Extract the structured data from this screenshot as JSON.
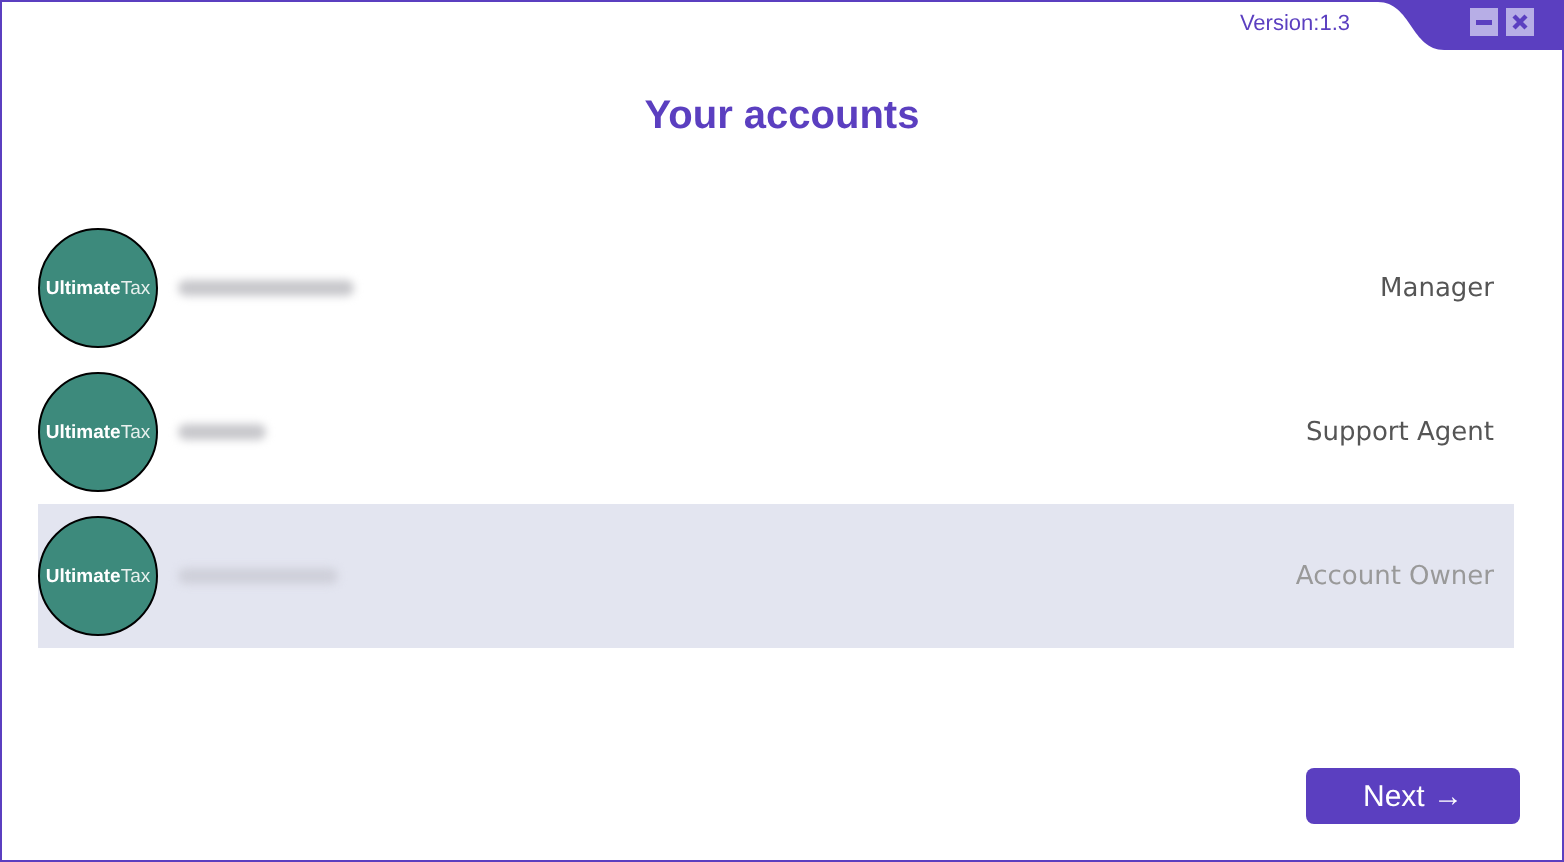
{
  "window": {
    "version": "Version:1.3",
    "controls": [
      {
        "kind": "minimize"
      },
      {
        "kind": "close"
      }
    ]
  },
  "title": "Your accounts",
  "accounts": [
    {
      "avatar": {
        "bold": "Ultimate",
        "light": "Tax"
      },
      "name_blurred": true,
      "role": "Manager",
      "selected": false
    },
    {
      "avatar": {
        "bold": "Ultimate",
        "light": "Tax"
      },
      "name_blurred": true,
      "role": "Support Agent",
      "selected": false
    },
    {
      "avatar": {
        "bold": "Ultimate",
        "light": "Tax"
      },
      "name_blurred": true,
      "role": "Account Owner",
      "selected": true
    }
  ],
  "next_button": "Next →"
}
